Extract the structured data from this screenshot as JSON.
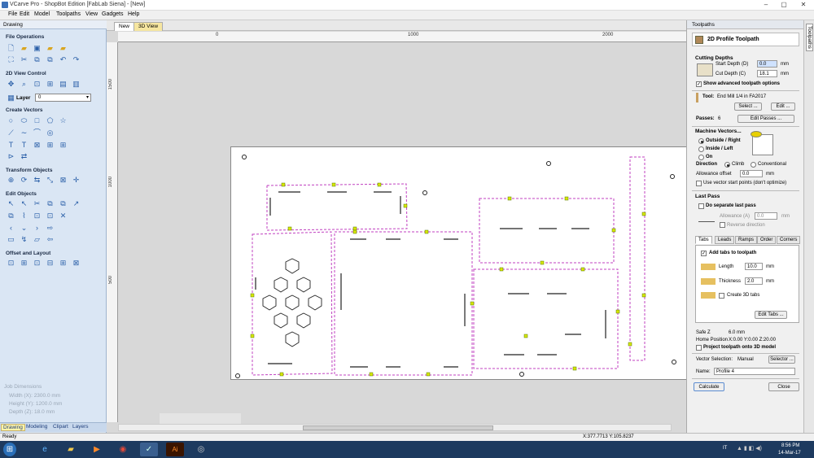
{
  "window": {
    "title": "VCarve Pro - ShopBot Edition [FabLab Siena] - [New]",
    "minimize": "–",
    "maximize": "▢",
    "close": "✕"
  },
  "menu": [
    "File",
    "Edit",
    "Model",
    "Toolpaths",
    "View",
    "Gadgets",
    "Help"
  ],
  "left_panel": {
    "header": "Drawing",
    "sections": {
      "file_ops": "File Operations",
      "view2d": "2D View Control",
      "create_vectors": "Create Vectors",
      "transform": "Transform Objects",
      "edit_objects": "Edit Objects",
      "offset_layout": "Offset and Layout"
    },
    "layer_label": "Layer",
    "layer_value": "0",
    "job_dimensions": {
      "title": "Job Dimensions",
      "width": "Width  (X): 2300.0 mm",
      "height": "Height (Y): 1200.0 mm",
      "depth": "Depth  (Z): 18.0 mm"
    },
    "tabs": [
      "Drawing",
      "Modeling",
      "Clipart",
      "Layers"
    ]
  },
  "document": {
    "tabs": [
      "New",
      "3D View"
    ],
    "ruler_h": [
      "0",
      "1000",
      "2000"
    ],
    "ruler_v": [
      "1500",
      "1000",
      "500"
    ]
  },
  "toolpaths": {
    "panel_title": "Toolpaths",
    "side_tab": "Toolpaths",
    "tool_title": "2D Profile Toolpath",
    "cutting_depths": "Cutting Depths",
    "start_depth_label": "Start Depth (D)",
    "start_depth": "0.0",
    "cut_depth_label": "Cut Depth (C)",
    "cut_depth": "18.1",
    "unit": "mm",
    "show_advanced": "Show advanced toolpath options",
    "tool_label": "Tool:",
    "tool_value": "End Mill 1/4 in FA2017",
    "select_btn": "Select ...",
    "edit_btn": "Edit ...",
    "passes_label": "Passes:",
    "passes_value": "6",
    "edit_passes_btn": "Edit Passes ...",
    "machine_vectors": "Machine Vectors...",
    "outside_right": "Outside / Right",
    "inside_left": "Inside / Left",
    "on": "On",
    "direction_label": "Direction",
    "climb": "Climb",
    "conventional": "Conventional",
    "allowance_offset_label": "Allowance offset",
    "allowance_offset": "0.0",
    "use_vector_start": "Use vector start points (don't optimize)",
    "last_pass": "Last Pass",
    "do_separate": "Do separate last pass",
    "allowance_a_label": "Allowance (A)",
    "allowance_a": "0.0",
    "reverse_direction": "Reverse direction",
    "sub_tabs": [
      "Tabs",
      "Leads",
      "Ramps",
      "Order",
      "Corners"
    ],
    "add_tabs": "Add tabs to toolpath",
    "length_label": "Length",
    "length_value": "10.0",
    "thickness_label": "Thickness",
    "thickness_value": "2.0",
    "create_3d_tabs": "Create 3D tabs",
    "edit_tabs_btn": "Edit Tabs ...",
    "safe_z": "Safe Z",
    "safe_z_value": "6.0 mm",
    "home_position": "Home Position",
    "home_value": "X:0.00 Y:0.00 Z:20.00",
    "project_toolpath": "Project toolpath onto 3D model",
    "vector_selection_label": "Vector Selection:",
    "vector_selection_value": "Manual",
    "selector_btn": "Selector ...",
    "name_label": "Name:",
    "name_value": "Profile 4",
    "calculate_btn": "Calculate",
    "close_btn": "Close"
  },
  "status": {
    "left": "Ready",
    "coords": "X:377.7713 Y:105.8237"
  },
  "taskbar": {
    "lang": "IT",
    "time": "8:56 PM",
    "date": "14-Mar-17"
  }
}
